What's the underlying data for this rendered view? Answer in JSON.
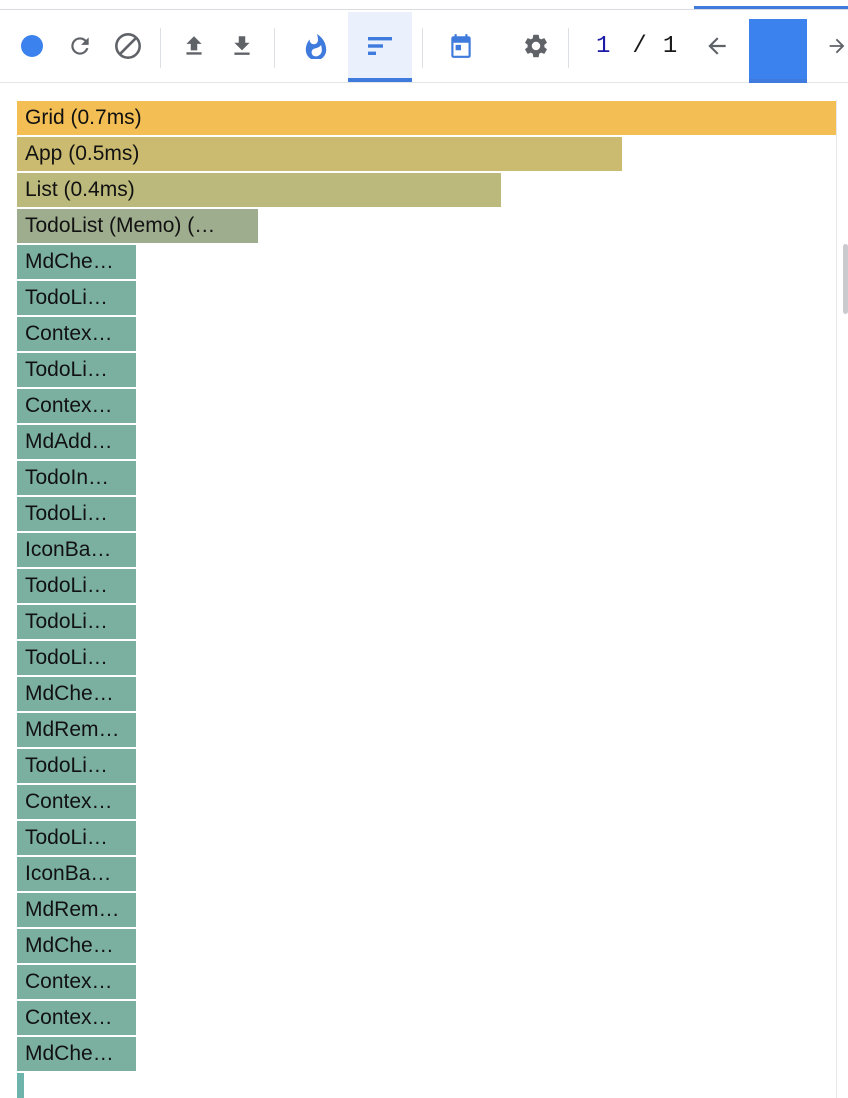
{
  "toolbar": {
    "commit_current": "1",
    "commit_sep": "/",
    "commit_total": "1",
    "colors": {
      "accent": "#3e7bdc",
      "icon": "#5f6368",
      "record_dot": "#3b82ef",
      "active_tab_bg": "#eaf1fd"
    },
    "icons": [
      "record-icon",
      "reload-icon",
      "clear-icon",
      "upload-icon",
      "download-icon",
      "flamegraph-icon",
      "ranked-icon",
      "timeline-icon",
      "settings-icon",
      "arrow-left-icon",
      "arrow-right-icon"
    ]
  },
  "flamegraph": {
    "bars": [
      {
        "label": "Grid (0.7ms)",
        "color": "#f3bf55"
      },
      {
        "label": "App (0.5ms)",
        "color": "#cbbb71"
      },
      {
        "label": "List (0.4ms)",
        "color": "#bbb97b"
      },
      {
        "label": "TodoList (Memo) (…",
        "color": "#9fad8f"
      },
      {
        "label": "MdChe…",
        "color": "#7bb0a1"
      },
      {
        "label": "TodoLi…",
        "color": "#7bb0a1"
      },
      {
        "label": "Contex…",
        "color": "#7bb0a1"
      },
      {
        "label": "TodoLi…",
        "color": "#7bb0a1"
      },
      {
        "label": "Contex…",
        "color": "#7bb0a1"
      },
      {
        "label": "MdAdd…",
        "color": "#7bb0a1"
      },
      {
        "label": "TodoIn…",
        "color": "#7bb0a1"
      },
      {
        "label": "TodoLi…",
        "color": "#7bb0a1"
      },
      {
        "label": "IconBa…",
        "color": "#7bb0a1"
      },
      {
        "label": "TodoLi…",
        "color": "#7bb0a1"
      },
      {
        "label": "TodoLi…",
        "color": "#7bb0a1"
      },
      {
        "label": "TodoLi…",
        "color": "#7bb0a1"
      },
      {
        "label": "MdChe…",
        "color": "#7bb0a1"
      },
      {
        "label": "MdRem…",
        "color": "#7bb0a1"
      },
      {
        "label": "TodoLi…",
        "color": "#7bb0a1"
      },
      {
        "label": "Contex…",
        "color": "#7bb0a1"
      },
      {
        "label": "TodoLi…",
        "color": "#7bb0a1"
      },
      {
        "label": "IconBa…",
        "color": "#7bb0a1"
      },
      {
        "label": "MdRem…",
        "color": "#7bb0a1"
      },
      {
        "label": "MdChe…",
        "color": "#7bb0a1"
      },
      {
        "label": "Contex…",
        "color": "#7bb0a1"
      },
      {
        "label": "Contex…",
        "color": "#7bb0a1"
      },
      {
        "label": "MdChe…",
        "color": "#7bb0a1"
      }
    ]
  }
}
